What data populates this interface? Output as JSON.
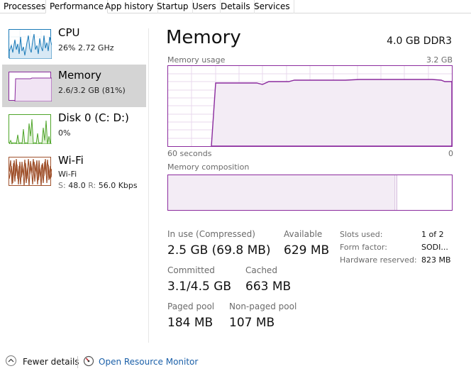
{
  "tabs": [
    {
      "label": "Processes"
    },
    {
      "label": "Performance"
    },
    {
      "label": "App history"
    },
    {
      "label": "Startup"
    },
    {
      "label": "Users"
    },
    {
      "label": "Details"
    },
    {
      "label": "Services"
    }
  ],
  "active_tab": "Performance",
  "sidebar": {
    "items": [
      {
        "title": "CPU",
        "sub": "26%  2.72 GHz",
        "color": "#1a7ab8",
        "icon": "cpu-graph-icon"
      },
      {
        "title": "Memory",
        "sub": "2.6/3.2 GB (81%)",
        "color": "#8b2b9e",
        "icon": "memory-graph-icon"
      },
      {
        "title": "Disk 0 (C: D:)",
        "sub": "0%",
        "color": "#4fa52a",
        "icon": "disk-graph-icon"
      },
      {
        "title": "Wi-Fi",
        "sub": "Wi-Fi",
        "send_label": "S:",
        "send_value": "48.0",
        "recv_label": "R:",
        "recv_value": "56.0 Kbps",
        "color": "#a0522d",
        "icon": "wifi-graph-icon"
      }
    ]
  },
  "main": {
    "title": "Memory",
    "spec": "4.0 GB DDR3",
    "usage_label": "Memory usage",
    "usage_max": "3.2 GB",
    "time_left": "60 seconds",
    "time_right": "0",
    "composition_label": "Memory composition",
    "accent": "#8b2b9e"
  },
  "stats": {
    "in_use_label": "In use (Compressed)",
    "in_use_value": "2.5 GB (69.8 MB)",
    "available_label": "Available",
    "available_value": "629 MB",
    "committed_label": "Committed",
    "committed_value": "3.1/4.5 GB",
    "cached_label": "Cached",
    "cached_value": "663 MB",
    "paged_label": "Paged pool",
    "paged_value": "184 MB",
    "nonpaged_label": "Non-paged pool",
    "nonpaged_value": "107 MB"
  },
  "specs": {
    "slots_label": "Slots used:",
    "slots_value": "1 of 2",
    "form_label": "Form factor:",
    "form_value": "SODI...",
    "reserved_label": "Hardware reserved:",
    "reserved_value": "823 MB"
  },
  "footer": {
    "fewer_details": "Fewer details",
    "open_monitor": "Open Resource Monitor"
  }
}
